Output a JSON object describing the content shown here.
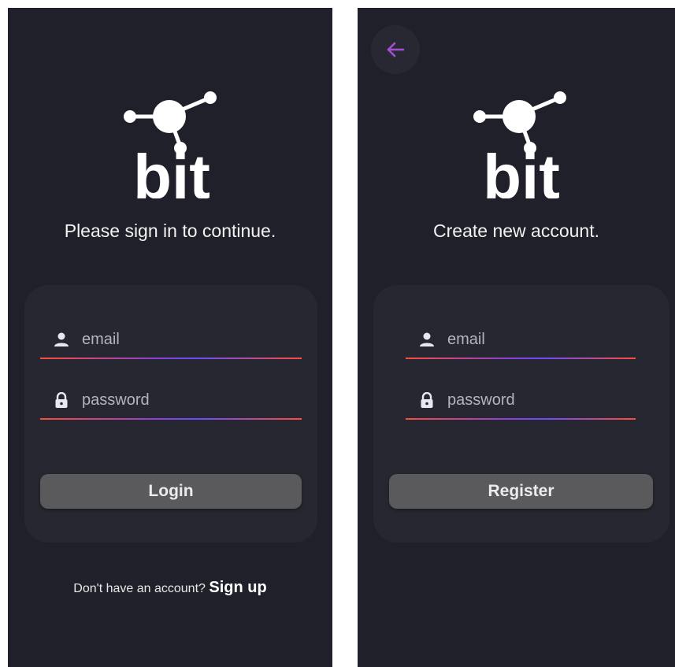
{
  "colors": {
    "background": "#20202a",
    "card": "#272731",
    "button": "#5a5a5c",
    "accent_purple": "#a64dd6",
    "underline_red": "#ff4a3d",
    "underline_violet": "#6a4bff"
  },
  "logo": {
    "wordmark": "bit"
  },
  "login": {
    "subtitle": "Please sign in to continue.",
    "email": {
      "placeholder": "email",
      "icon": "person-icon"
    },
    "password": {
      "placeholder": "password",
      "icon": "lock-icon"
    },
    "button_label": "Login",
    "footer_prompt": "Don't have an account?",
    "footer_link": "Sign up"
  },
  "register": {
    "back_icon": "arrow-left-icon",
    "subtitle": "Create new account.",
    "email": {
      "placeholder": "email",
      "icon": "person-icon"
    },
    "password": {
      "placeholder": "password",
      "icon": "lock-icon"
    },
    "button_label": "Register"
  }
}
